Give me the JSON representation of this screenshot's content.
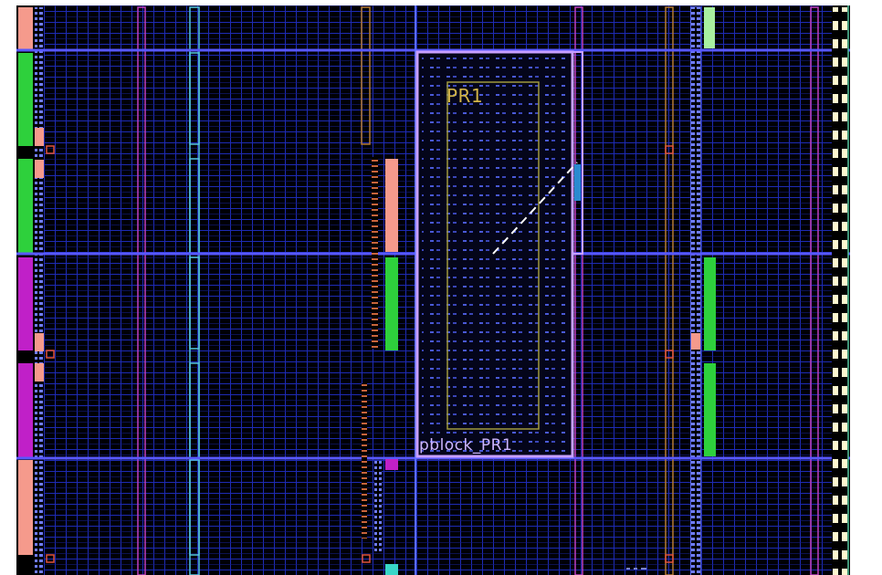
{
  "device_view": {
    "colors": {
      "background": "#000000",
      "fabric_grid": "#1e2bb5",
      "clock_region_line": "#5858ff",
      "column_blue": "#6f7cff",
      "column_magenta": "#c040c0",
      "column_cyan": "#55c8e0",
      "column_orange": "#b67a32",
      "pblock_outline": "#c8a0ff",
      "pr1_outline": "#a09a3c",
      "pr1_label": "#d2b448",
      "pblock_label": "#cdb6ff",
      "net_line": "#ffffff",
      "green": "#2ed03c",
      "magenta": "#c020c8",
      "salmon": "#f59a8c",
      "light_green": "#a8f0a0",
      "cream": "#fff8d0",
      "teal": "#38d6c8"
    },
    "pblock_name": "pblock_PR1",
    "partition_name": "PR1"
  }
}
